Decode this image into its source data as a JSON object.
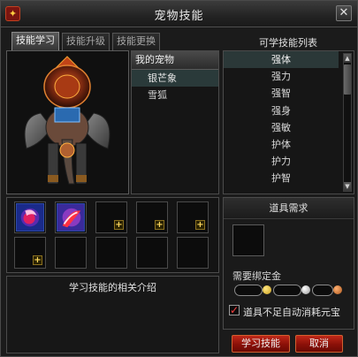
{
  "window": {
    "title": "宠物技能",
    "close_label": "✕",
    "title_icon": "pet-skill-icon"
  },
  "tabs": [
    {
      "label": "技能学习",
      "active": true
    },
    {
      "label": "技能升级",
      "active": false
    },
    {
      "label": "技能更换",
      "active": false
    }
  ],
  "pet_list": {
    "header": "我的宠物",
    "items": [
      {
        "name": "银芒象",
        "selected": true
      },
      {
        "name": "雪狐",
        "selected": false
      }
    ]
  },
  "skills": {
    "heading": "可学技能列表",
    "items": [
      {
        "name": "强体",
        "selected": true
      },
      {
        "name": "强力",
        "selected": false
      },
      {
        "name": "强智",
        "selected": false
      },
      {
        "name": "强身",
        "selected": false
      },
      {
        "name": "强敏",
        "selected": false
      },
      {
        "name": "护体",
        "selected": false
      },
      {
        "name": "护力",
        "selected": false
      },
      {
        "name": "护智",
        "selected": false
      }
    ],
    "scroll_up": "▲",
    "scroll_down": "▼"
  },
  "skill_slots": {
    "filled": [
      "learned-skill-icon",
      "learned-skill-icon"
    ],
    "plus_label": "+"
  },
  "description": {
    "title": "学习技能的相关介绍"
  },
  "requirement": {
    "title": "道具需求",
    "gold_label": "需要绑定金",
    "gold_value": "",
    "silver_value": "",
    "copper_value": "",
    "auto_consume_label": "道具不足自动消耗元宝",
    "auto_consume_checked": true,
    "check_mark": "✓"
  },
  "buttons": {
    "learn": "学习技能",
    "cancel": "取消"
  },
  "colors": {
    "accent_red": "#8a1008",
    "selection": "#2a3a3a",
    "gold_text": "#ffd860"
  }
}
